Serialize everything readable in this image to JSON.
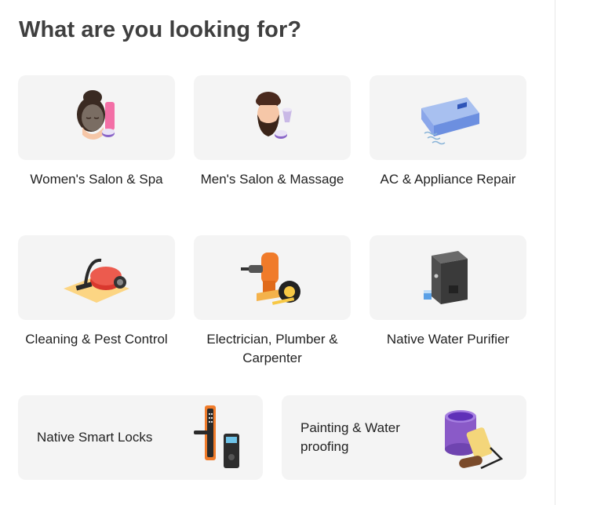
{
  "page_title": "What are you looking for?",
  "categories": [
    {
      "label": "Women's Salon & Spa",
      "icon": "woman-face-mask-icon"
    },
    {
      "label": "Men's Salon & Massage",
      "icon": "man-beard-icon"
    },
    {
      "label": "AC & Appliance Repair",
      "icon": "air-conditioner-icon"
    },
    {
      "label": "Cleaning & Pest Control",
      "icon": "vacuum-cleaner-icon"
    },
    {
      "label": "Electrician, Plumber & Carpenter",
      "icon": "drill-tape-icon"
    },
    {
      "label": "Native Water Purifier",
      "icon": "water-purifier-icon"
    },
    {
      "label": "Native Smart Locks",
      "icon": "smart-lock-icon"
    },
    {
      "label": "Painting & Water proofing",
      "icon": "paint-roller-icon"
    }
  ],
  "colors": {
    "card_bg": "#f4f4f4",
    "title": "#3f3f3f",
    "text": "#222222"
  }
}
